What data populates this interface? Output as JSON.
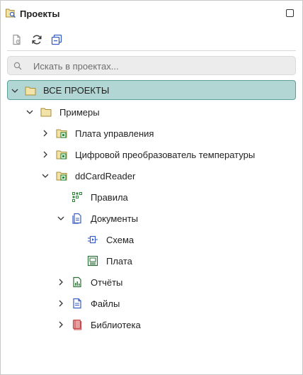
{
  "header": {
    "title": "Проекты"
  },
  "search": {
    "placeholder": "Искать в проектах..."
  },
  "tree": {
    "root": "ВСЕ ПРОЕКТЫ",
    "examples": "Примеры",
    "control_board": "Плата управления",
    "temp_converter": "Цифровой преобразователь температуры",
    "ddcardreader": "ddCardReader",
    "rules": "Правила",
    "documents": "Документы",
    "schema": "Схема",
    "board": "Плата",
    "reports": "Отчёты",
    "files": "Файлы",
    "library": "Библиотека"
  },
  "colors": {
    "selection_bg": "#b2d6d4",
    "selection_border": "#5d9f9b",
    "folder_fill": "#f2e4a8",
    "folder_stroke": "#a88d3a",
    "project_green": "#2e8b3d",
    "doc_blue": "#3a5fc4",
    "library_red": "#c94a4a"
  }
}
